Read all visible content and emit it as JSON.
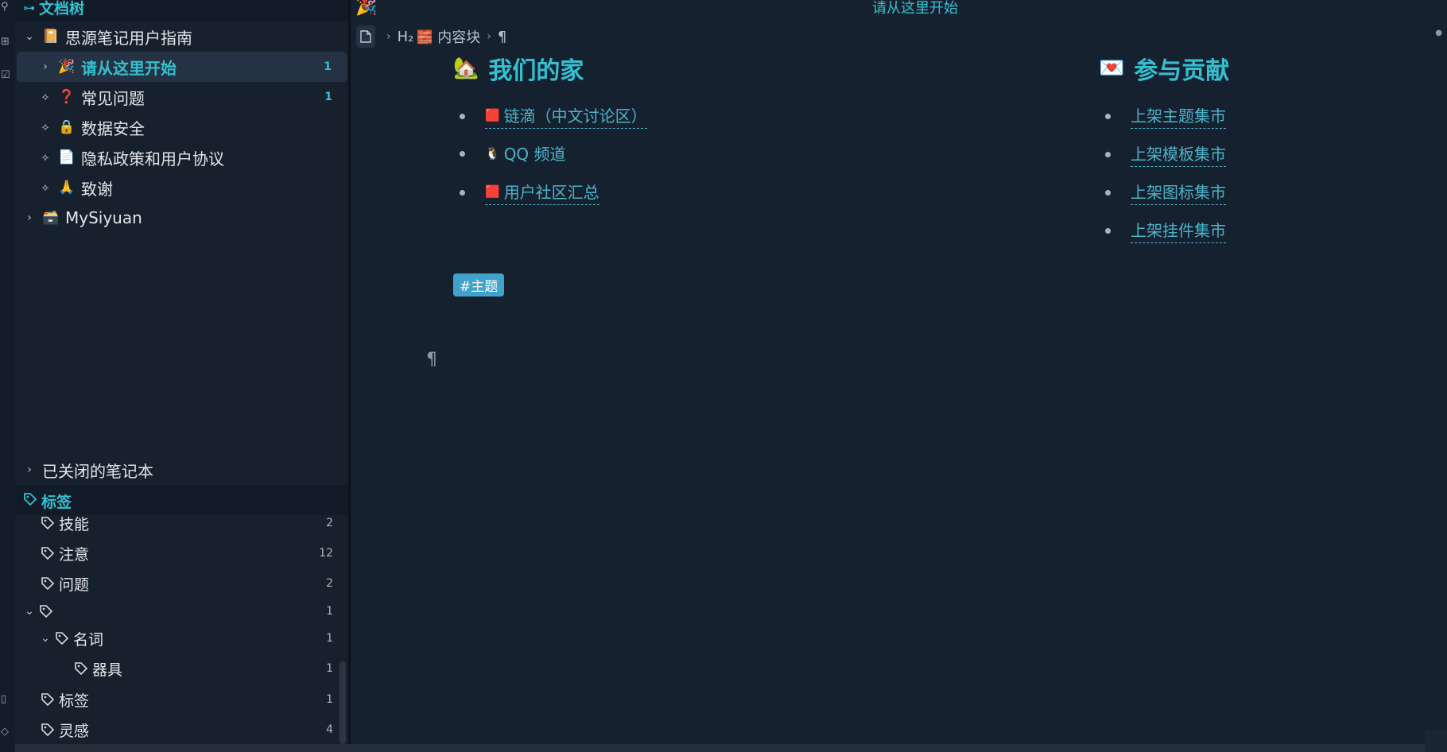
{
  "dock": {
    "icons": [
      "branch-icon",
      "graph-icon",
      "outline-icon",
      "bookmark-icon",
      "tag-icon"
    ]
  },
  "file_tree": {
    "title": "文档树",
    "items": [
      {
        "label": "思源笔记用户指南",
        "emoji": "📔",
        "expanded": true,
        "level": 0
      },
      {
        "label": "请从这里开始",
        "emoji": "🎉",
        "count": "1",
        "active": true,
        "level": 1
      },
      {
        "label": "常见问题",
        "emoji": "❓",
        "count": "1",
        "level": 1
      },
      {
        "label": "数据安全",
        "emoji": "🔒",
        "level": 1
      },
      {
        "label": "隐私政策和用户协议",
        "emoji": "📄",
        "level": 1
      },
      {
        "label": "致谢",
        "emoji": "🙏",
        "level": 1
      },
      {
        "label": "MySiyuan",
        "emoji": "🗃️",
        "level": 0
      }
    ],
    "closed_notebooks": "已关闭的笔记本"
  },
  "tags": {
    "title": "标签",
    "items": [
      {
        "label": "技能",
        "count": "2"
      },
      {
        "label": "注意",
        "count": "12"
      },
      {
        "label": "问题",
        "count": "2"
      },
      {
        "label": "",
        "count": "1"
      },
      {
        "label": "名词",
        "count": "1"
      },
      {
        "label": "器具",
        "count": "1"
      },
      {
        "label": "标签",
        "count": "1"
      },
      {
        "label": "灵感",
        "count": "4"
      }
    ]
  },
  "editor": {
    "tab_emoji": "🎉",
    "tab_title": "请从这里开始",
    "breadcrumb": {
      "h2": "H₂",
      "block_emoji": "🧱",
      "block": "内容块",
      "pilcrow": "¶"
    },
    "left_heading": {
      "emoji": "🏡",
      "text": "我们的家"
    },
    "left_links": [
      {
        "emoji": "🟥",
        "text": "链滴（中文讨论区）"
      },
      {
        "emoji": "🐧",
        "text": "QQ 频道"
      },
      {
        "emoji": "🟥",
        "text": "用户社区汇总"
      }
    ],
    "right_heading": {
      "emoji": "💌",
      "text": "参与贡献"
    },
    "right_links": [
      {
        "text": "上架主题集市"
      },
      {
        "text": "上架模板集市"
      },
      {
        "text": "上架图标集市"
      },
      {
        "text": "上架挂件集市"
      }
    ],
    "tag_chip": "#主题",
    "pilcrow": "¶"
  },
  "colors": {
    "accent": "#34c0d0",
    "link": "#4db2c9",
    "tag_chip": "#3fa3cc",
    "background": "#162130"
  }
}
